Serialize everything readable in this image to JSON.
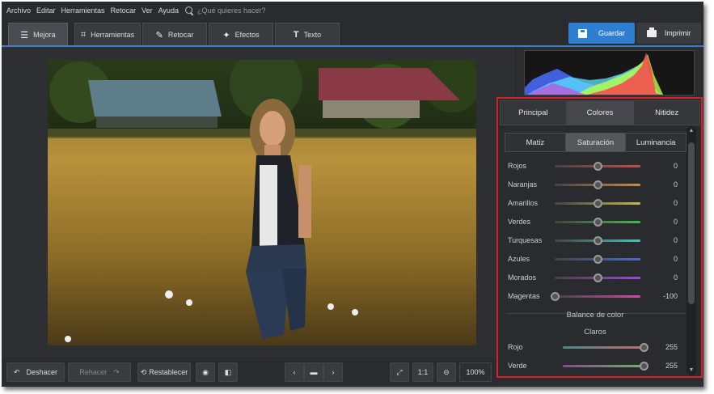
{
  "menu": {
    "items": [
      "Archivo",
      "Editar",
      "Herramientas",
      "Retocar",
      "Ver",
      "Ayuda"
    ],
    "search_placeholder": "¿Qué quieres hacer?"
  },
  "toolbar": {
    "tabs": [
      {
        "label": "Mejora",
        "icon": "sliders-icon"
      },
      {
        "label": "Herramientas",
        "icon": "crop-icon"
      },
      {
        "label": "Retocar",
        "icon": "brush-icon"
      },
      {
        "label": "Efectos",
        "icon": "magic-wand-icon"
      },
      {
        "label": "Texto",
        "icon": "text-icon"
      }
    ],
    "active_tab": "Mejora",
    "save_label": "Guardar",
    "print_label": "Imprimir"
  },
  "panel": {
    "tabs": [
      "Principal",
      "Colores",
      "Nitidez"
    ],
    "active_tab": "Colores",
    "subtabs": [
      "Matiz",
      "Saturación",
      "Luminancia"
    ],
    "active_subtab": "Saturación",
    "sliders": [
      {
        "label": "Rojos",
        "value": "0"
      },
      {
        "label": "Naranjas",
        "value": "0"
      },
      {
        "label": "Amarillos",
        "value": "0"
      },
      {
        "label": "Verdes",
        "value": "0"
      },
      {
        "label": "Turquesas",
        "value": "0"
      },
      {
        "label": "Azules",
        "value": "0"
      },
      {
        "label": "Morados",
        "value": "0"
      },
      {
        "label": "Magentas",
        "value": "-100"
      }
    ],
    "balance_title": "Balance de color",
    "claros_title": "Claros",
    "balance_sliders": [
      {
        "label": "Rojo",
        "value": "255"
      },
      {
        "label": "Verde",
        "value": "255"
      }
    ]
  },
  "bottom": {
    "undo_label": "Deshacer",
    "redo_label": "Rehacer",
    "reset_label": "Restablecer",
    "ratio_label": "1:1",
    "zoom_label": "100%"
  },
  "colors": {
    "accent": "#2f7fd0",
    "highlight_border": "#d9202a"
  }
}
